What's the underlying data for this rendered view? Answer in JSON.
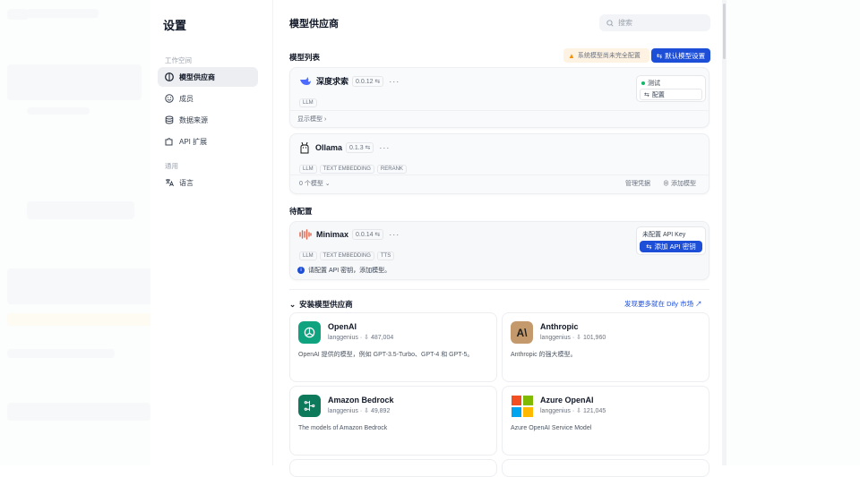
{
  "settings": {
    "title": "设置",
    "group_workspace": "工作空间",
    "group_general": "通用",
    "nav": [
      {
        "label": "模型供应商"
      },
      {
        "label": "成员"
      },
      {
        "label": "数据来源"
      },
      {
        "label": "API 扩展"
      },
      {
        "label": "语言"
      }
    ]
  },
  "main": {
    "title": "模型供应商",
    "search_placeholder": "搜索",
    "model_list_label": "模型列表",
    "warning": "系统模型尚未完全配置",
    "default_model_btn": "默认模型设置",
    "pending_label": "待配置",
    "install_label": "安装模型供应商",
    "marketplace_link": "发现更多就在 Dify 市场 ↗"
  },
  "providers_configured": [
    {
      "name": "深度求索",
      "version": "0.0.12",
      "tags": [
        "LLM"
      ],
      "status": "测试",
      "config_btn": "配置",
      "footer": "显示模型"
    },
    {
      "name": "Ollama",
      "version": "0.1.3",
      "tags": [
        "LLM",
        "TEXT EMBEDDING",
        "RERANK"
      ],
      "footer": "0 个模型",
      "manage": "管理凭据",
      "add_model": "添加模型"
    }
  ],
  "pending": {
    "name": "Minimax",
    "version": "0.0.14",
    "tags": [
      "LLM",
      "TEXT EMBEDDING",
      "TTS"
    ],
    "setup_key": "未配置 API Key",
    "add_key": "添加 API 密钥",
    "notice": "请配置 API 密钥，添加模型。"
  },
  "install": [
    {
      "name": "OpenAI",
      "author": "langgenius",
      "downloads": "487,004",
      "desc": "OpenAI 提供的模型，例如 GPT-3.5-Turbo、GPT-4 和 GPT-5。",
      "icon": "openai-icon",
      "color": "#10a37f"
    },
    {
      "name": "Anthropic",
      "author": "langgenius",
      "downloads": "101,960",
      "desc": "Anthropic 的强大模型。",
      "icon": "anthropic-icon",
      "color": "#c49a6c"
    },
    {
      "name": "Amazon Bedrock",
      "author": "langgenius",
      "downloads": "49,892",
      "desc": "The models of Amazon Bedrock",
      "icon": "bedrock-icon",
      "color": "#0e7a5c"
    },
    {
      "name": "Azure OpenAI",
      "author": "langgenius",
      "downloads": "121,045",
      "desc": "Azure OpenAI Service Model",
      "icon": "azure-icon",
      "color": "#f25022"
    }
  ]
}
